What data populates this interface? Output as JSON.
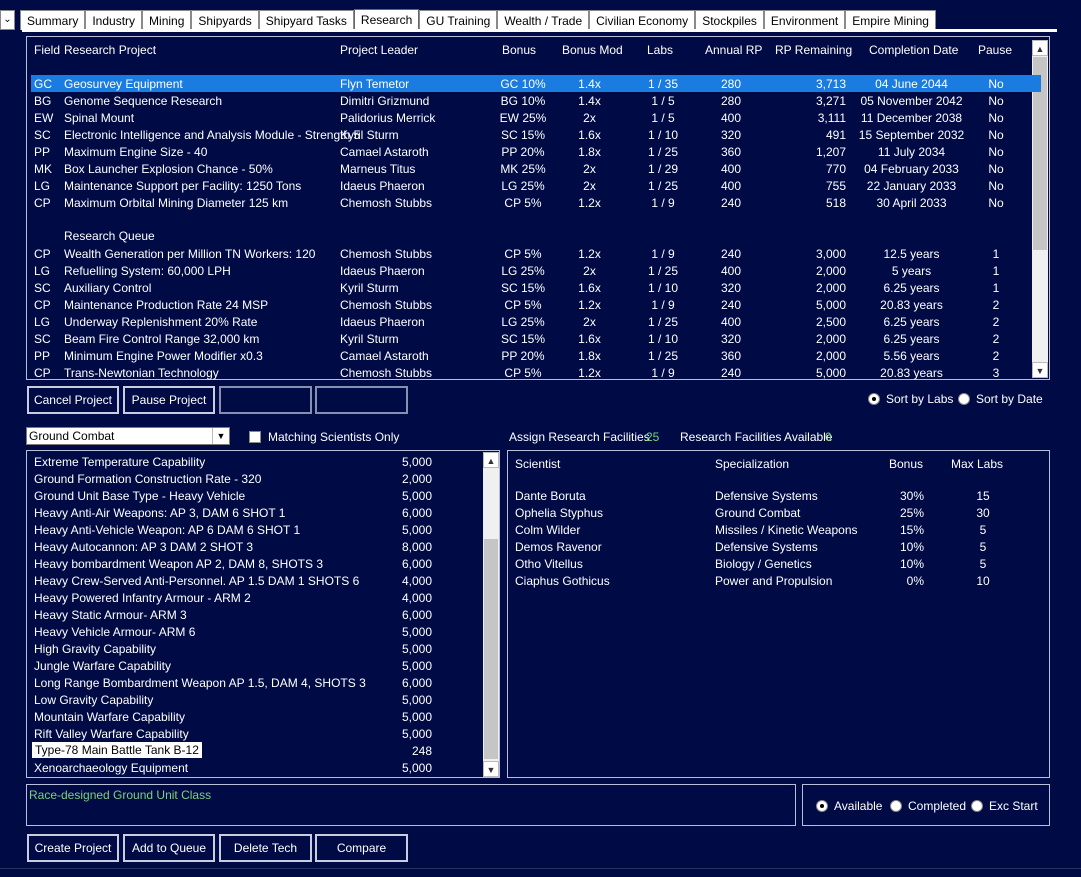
{
  "tabs": [
    "Summary",
    "Industry",
    "Mining",
    "Shipyards",
    "Shipyard Tasks",
    "Research",
    "GU Training",
    "Wealth / Trade",
    "Civilian Economy",
    "Stockpiles",
    "Environment",
    "Empire Mining"
  ],
  "active_tab": "Research",
  "projects": {
    "headers": {
      "field": "Field",
      "project": "Research Project",
      "leader": "Project Leader",
      "bonus": "Bonus",
      "bonus_mod": "Bonus Mod",
      "labs": "Labs",
      "annual_rp": "Annual RP",
      "rp_remaining": "RP Remaining",
      "completion": "Completion Date",
      "pause": "Pause"
    },
    "active": [
      {
        "field": "GC",
        "project": "Geosurvey Equipment",
        "leader": "Flyn Temetor",
        "bonus": "GC 10%",
        "bonus_mod": "1.4x",
        "labs": "1 / 35",
        "annual_rp": "280",
        "rp_remaining": "3,713",
        "completion": "04 June 2044",
        "pause": "No"
      },
      {
        "field": "BG",
        "project": "Genome Sequence Research",
        "leader": "Dimitri Grizmund",
        "bonus": "BG 10%",
        "bonus_mod": "1.4x",
        "labs": "1 / 5",
        "annual_rp": "280",
        "rp_remaining": "3,271",
        "completion": "05 November 2042",
        "pause": "No"
      },
      {
        "field": "EW",
        "project": "Spinal Mount",
        "leader": "Palidorius Merrick",
        "bonus": "EW 25%",
        "bonus_mod": "2x",
        "labs": "1 / 5",
        "annual_rp": "400",
        "rp_remaining": "3,111",
        "completion": "11 December 2038",
        "pause": "No"
      },
      {
        "field": "SC",
        "project": "Electronic Intelligence and Analysis Module - Strength 5",
        "leader": "Kyril Sturm",
        "bonus": "SC 15%",
        "bonus_mod": "1.6x",
        "labs": "1 / 10",
        "annual_rp": "320",
        "rp_remaining": "491",
        "completion": "15 September 2032",
        "pause": "No"
      },
      {
        "field": "PP",
        "project": "Maximum Engine Size - 40",
        "leader": "Camael Astaroth",
        "bonus": "PP 20%",
        "bonus_mod": "1.8x",
        "labs": "1 / 25",
        "annual_rp": "360",
        "rp_remaining": "1,207",
        "completion": "11 July 2034",
        "pause": "No"
      },
      {
        "field": "MK",
        "project": "Box Launcher Explosion Chance - 50%",
        "leader": "Marneus Titus",
        "bonus": "MK 25%",
        "bonus_mod": "2x",
        "labs": "1 / 29",
        "annual_rp": "400",
        "rp_remaining": "770",
        "completion": "04 February 2033",
        "pause": "No"
      },
      {
        "field": "LG",
        "project": "Maintenance Support per Facility: 1250 Tons",
        "leader": "Idaeus Phaeron",
        "bonus": "LG 25%",
        "bonus_mod": "2x",
        "labs": "1 / 25",
        "annual_rp": "400",
        "rp_remaining": "755",
        "completion": "22 January 2033",
        "pause": "No"
      },
      {
        "field": "CP",
        "project": "Maximum Orbital Mining Diameter 125 km",
        "leader": "Chemosh Stubbs",
        "bonus": "CP 5%",
        "bonus_mod": "1.2x",
        "labs": "1 / 9",
        "annual_rp": "240",
        "rp_remaining": "518",
        "completion": "30 April 2033",
        "pause": "No"
      }
    ],
    "queue_label": "Research Queue",
    "queue": [
      {
        "field": "CP",
        "project": "Wealth Generation per Million TN Workers: 120",
        "leader": "Chemosh Stubbs",
        "bonus": "CP 5%",
        "bonus_mod": "1.2x",
        "labs": "1 / 9",
        "annual_rp": "240",
        "rp_remaining": "3,000",
        "completion": "12.5 years",
        "pause": "1"
      },
      {
        "field": "LG",
        "project": "Refuelling System: 60,000 LPH",
        "leader": "Idaeus Phaeron",
        "bonus": "LG 25%",
        "bonus_mod": "2x",
        "labs": "1 / 25",
        "annual_rp": "400",
        "rp_remaining": "2,000",
        "completion": "5 years",
        "pause": "1"
      },
      {
        "field": "SC",
        "project": "Auxiliary Control",
        "leader": "Kyril Sturm",
        "bonus": "SC 15%",
        "bonus_mod": "1.6x",
        "labs": "1 / 10",
        "annual_rp": "320",
        "rp_remaining": "2,000",
        "completion": "6.25 years",
        "pause": "1"
      },
      {
        "field": "CP",
        "project": "Maintenance Production Rate 24 MSP",
        "leader": "Chemosh Stubbs",
        "bonus": "CP 5%",
        "bonus_mod": "1.2x",
        "labs": "1 / 9",
        "annual_rp": "240",
        "rp_remaining": "5,000",
        "completion": "20.83 years",
        "pause": "2"
      },
      {
        "field": "LG",
        "project": "Underway Replenishment 20% Rate",
        "leader": "Idaeus Phaeron",
        "bonus": "LG 25%",
        "bonus_mod": "2x",
        "labs": "1 / 25",
        "annual_rp": "400",
        "rp_remaining": "2,500",
        "completion": "6.25 years",
        "pause": "2"
      },
      {
        "field": "SC",
        "project": "Beam Fire Control Range 32,000 km",
        "leader": "Kyril Sturm",
        "bonus": "SC 15%",
        "bonus_mod": "1.6x",
        "labs": "1 / 10",
        "annual_rp": "320",
        "rp_remaining": "2,000",
        "completion": "6.25 years",
        "pause": "2"
      },
      {
        "field": "PP",
        "project": "Minimum Engine Power Modifier x0.3",
        "leader": "Camael Astaroth",
        "bonus": "PP 20%",
        "bonus_mod": "1.8x",
        "labs": "1 / 25",
        "annual_rp": "360",
        "rp_remaining": "2,000",
        "completion": "5.56 years",
        "pause": "2"
      },
      {
        "field": "CP",
        "project": "Trans-Newtonian Technology",
        "leader": "Chemosh Stubbs",
        "bonus": "CP 5%",
        "bonus_mod": "1.2x",
        "labs": "1 / 9",
        "annual_rp": "240",
        "rp_remaining": "5,000",
        "completion": "20.83 years",
        "pause": "3"
      }
    ]
  },
  "buttons": {
    "cancel": "Cancel Project",
    "pause": "Pause Project",
    "create": "Create Project",
    "add_queue": "Add to Queue",
    "delete": "Delete Tech",
    "compare": "Compare"
  },
  "sort": {
    "labs": "Sort by Labs",
    "date": "Sort by Date",
    "selected": "labs"
  },
  "field_select": "Ground Combat",
  "matching_label": "Matching Scientists Only",
  "assign_label": "Assign Research Facilities",
  "assign_value": "25",
  "available_label": "Research Facilities Available",
  "available_value": "0",
  "techs": [
    {
      "name": "Extreme Temperature Capability",
      "cost": "5,000"
    },
    {
      "name": "Ground Formation Construction Rate - 320",
      "cost": "2,000"
    },
    {
      "name": "Ground Unit Base Type - Heavy Vehicle",
      "cost": "5,000"
    },
    {
      "name": "Heavy Anti-Air Weapons: AP 3, DAM 6 SHOT 1",
      "cost": "6,000"
    },
    {
      "name": "Heavy Anti-Vehicle Weapon: AP 6 DAM 6 SHOT 1",
      "cost": "5,000"
    },
    {
      "name": "Heavy Autocannon: AP 3 DAM 2 SHOT 3",
      "cost": "8,000"
    },
    {
      "name": "Heavy bombardment Weapon AP 2, DAM 8, SHOTS 3",
      "cost": "6,000"
    },
    {
      "name": "Heavy Crew-Served Anti-Personnel. AP 1.5 DAM 1 SHOTS 6",
      "cost": "4,000"
    },
    {
      "name": "Heavy Powered Infantry Armour - ARM 2",
      "cost": "4,000"
    },
    {
      "name": "Heavy Static Armour- ARM 3",
      "cost": "6,000"
    },
    {
      "name": "Heavy Vehicle Armour- ARM 6",
      "cost": "5,000"
    },
    {
      "name": "High Gravity Capability",
      "cost": "5,000"
    },
    {
      "name": "Jungle Warfare Capability",
      "cost": "5,000"
    },
    {
      "name": "Long Range Bombardment Weapon AP 1.5, DAM 4, SHOTS 3",
      "cost": "6,000"
    },
    {
      "name": "Low Gravity Capability",
      "cost": "5,000"
    },
    {
      "name": "Mountain Warfare Capability",
      "cost": "5,000"
    },
    {
      "name": "Rift Valley Warfare Capability",
      "cost": "5,000"
    },
    {
      "name": "Type-78 Main Battle Tank B-12",
      "cost": "248"
    },
    {
      "name": "Xenoarchaeology Equipment",
      "cost": "5,000"
    }
  ],
  "selected_tech": "Type-78 Main Battle Tank B-12",
  "sci_headers": {
    "scientist": "Scientist",
    "spec": "Specialization",
    "bonus": "Bonus",
    "max_labs": "Max Labs"
  },
  "scientists": [
    {
      "name": "Dante Boruta",
      "spec": "Defensive Systems",
      "bonus": "30%",
      "max_labs": "15"
    },
    {
      "name": "Ophelia Styphus",
      "spec": "Ground Combat",
      "bonus": "25%",
      "max_labs": "30"
    },
    {
      "name": "Colm Wilder",
      "spec": "Missiles / Kinetic Weapons",
      "bonus": "15%",
      "max_labs": "5"
    },
    {
      "name": "Demos Ravenor",
      "spec": "Defensive Systems",
      "bonus": "10%",
      "max_labs": "5"
    },
    {
      "name": "Otho Vitellus",
      "spec": "Biology / Genetics",
      "bonus": "10%",
      "max_labs": "5"
    },
    {
      "name": "Ciaphus Gothicus",
      "spec": "Power and Propulsion",
      "bonus": "0%",
      "max_labs": "10"
    }
  ],
  "description": "Race-designed Ground Unit Class",
  "filter": {
    "available": "Available",
    "completed": "Completed",
    "exc_start": "Exc Start",
    "selected": "available"
  }
}
